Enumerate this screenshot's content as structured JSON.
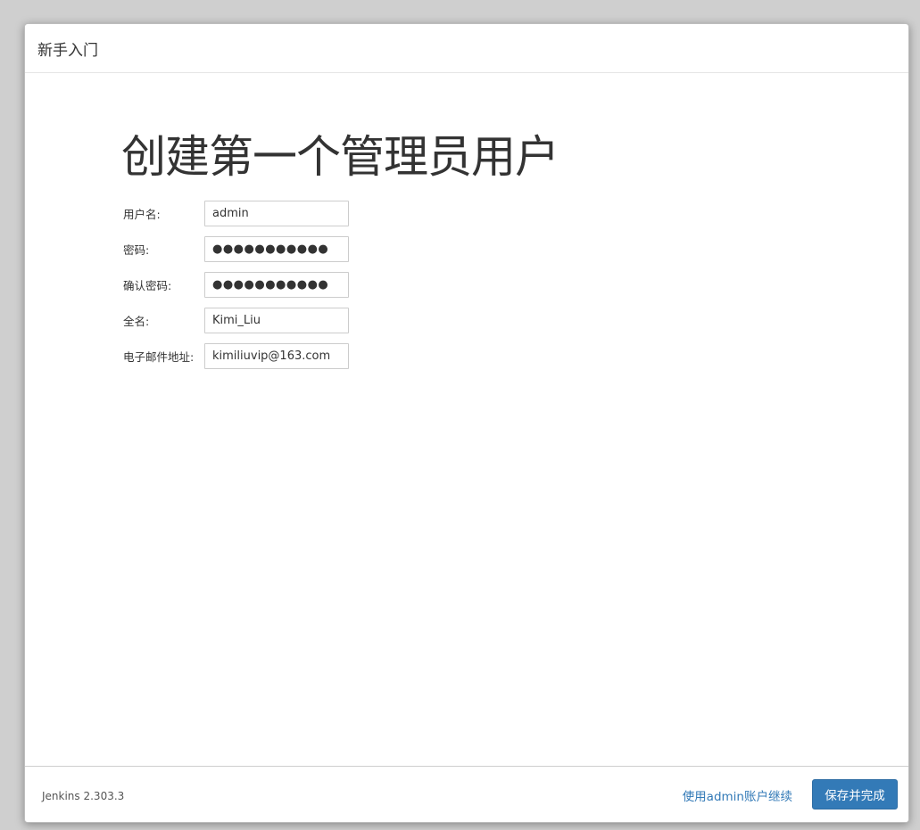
{
  "dialog": {
    "title": "新手入门"
  },
  "page": {
    "heading": "创建第一个管理员用户"
  },
  "form": {
    "fields": [
      {
        "label": "用户名:",
        "type": "text",
        "value": "admin"
      },
      {
        "label": "密码:",
        "type": "password",
        "value": "●●●●●●●●●●●"
      },
      {
        "label": "确认密码:",
        "type": "password",
        "value": "●●●●●●●●●●●"
      },
      {
        "label": "全名:",
        "type": "text",
        "value": "Kimi_Liu"
      },
      {
        "label": "电子邮件地址:",
        "type": "text",
        "value": "kimiliuvip@163.com"
      }
    ]
  },
  "footer": {
    "version": "Jenkins 2.303.3",
    "skip_link": "使用admin账户继续",
    "save_button": "保存并完成"
  },
  "colors": {
    "primary": "#337ab7",
    "backdrop": "#cfcfcf",
    "text": "#333333"
  }
}
